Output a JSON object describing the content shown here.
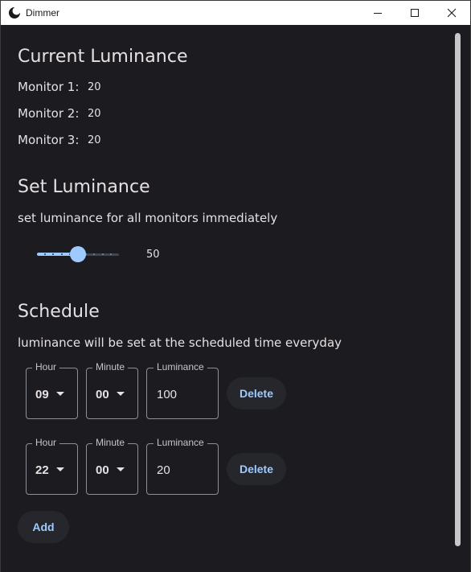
{
  "window": {
    "title": "Dimmer"
  },
  "current": {
    "heading": "Current Luminance",
    "monitors": [
      {
        "label": "Monitor 1:",
        "value": "20"
      },
      {
        "label": "Monitor 2:",
        "value": "20"
      },
      {
        "label": "Monitor 3:",
        "value": "20"
      }
    ]
  },
  "set": {
    "heading": "Set Luminance",
    "description": "set luminance for all monitors immediately",
    "slider_value": "50",
    "slider_fraction": 0.5,
    "slider_divisions": 10
  },
  "schedule": {
    "heading": "Schedule",
    "description": "luminance will be set at the scheduled time everyday",
    "hour_label": "Hour",
    "minute_label": "Minute",
    "luminance_label": "Luminance",
    "delete_label": "Delete",
    "rows": [
      {
        "hour": "09",
        "minute": "00",
        "luminance": "100"
      },
      {
        "hour": "22",
        "minute": "00",
        "luminance": "20"
      }
    ],
    "add_label": "Add"
  },
  "colors": {
    "accent": "#9ecaff",
    "background": "#1c1b1f",
    "button_bg": "#25272c"
  },
  "icons": {
    "app": "moon-icon",
    "minimize": "minimize-icon",
    "maximize": "maximize-icon",
    "close": "close-icon",
    "dropdown": "chevron-down-icon"
  }
}
